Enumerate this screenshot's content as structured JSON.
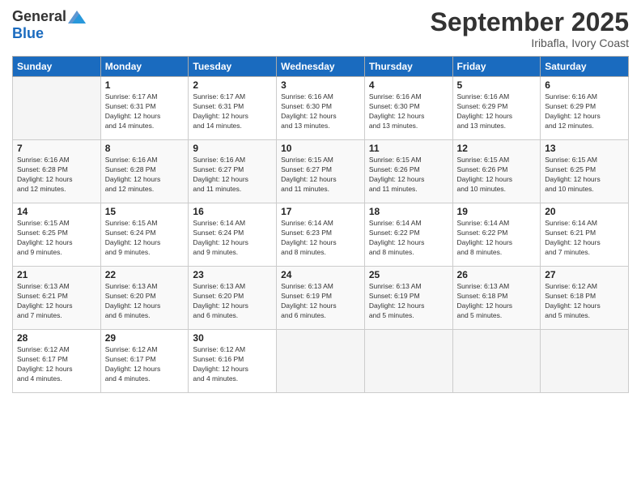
{
  "header": {
    "logo_general": "General",
    "logo_blue": "Blue",
    "month_title": "September 2025",
    "subtitle": "Iribafla, Ivory Coast"
  },
  "days_of_week": [
    "Sunday",
    "Monday",
    "Tuesday",
    "Wednesday",
    "Thursday",
    "Friday",
    "Saturday"
  ],
  "weeks": [
    [
      {
        "day": "",
        "info": ""
      },
      {
        "day": "1",
        "info": "Sunrise: 6:17 AM\nSunset: 6:31 PM\nDaylight: 12 hours\nand 14 minutes."
      },
      {
        "day": "2",
        "info": "Sunrise: 6:17 AM\nSunset: 6:31 PM\nDaylight: 12 hours\nand 14 minutes."
      },
      {
        "day": "3",
        "info": "Sunrise: 6:16 AM\nSunset: 6:30 PM\nDaylight: 12 hours\nand 13 minutes."
      },
      {
        "day": "4",
        "info": "Sunrise: 6:16 AM\nSunset: 6:30 PM\nDaylight: 12 hours\nand 13 minutes."
      },
      {
        "day": "5",
        "info": "Sunrise: 6:16 AM\nSunset: 6:29 PM\nDaylight: 12 hours\nand 13 minutes."
      },
      {
        "day": "6",
        "info": "Sunrise: 6:16 AM\nSunset: 6:29 PM\nDaylight: 12 hours\nand 12 minutes."
      }
    ],
    [
      {
        "day": "7",
        "info": "Sunrise: 6:16 AM\nSunset: 6:28 PM\nDaylight: 12 hours\nand 12 minutes."
      },
      {
        "day": "8",
        "info": "Sunrise: 6:16 AM\nSunset: 6:28 PM\nDaylight: 12 hours\nand 12 minutes."
      },
      {
        "day": "9",
        "info": "Sunrise: 6:16 AM\nSunset: 6:27 PM\nDaylight: 12 hours\nand 11 minutes."
      },
      {
        "day": "10",
        "info": "Sunrise: 6:15 AM\nSunset: 6:27 PM\nDaylight: 12 hours\nand 11 minutes."
      },
      {
        "day": "11",
        "info": "Sunrise: 6:15 AM\nSunset: 6:26 PM\nDaylight: 12 hours\nand 11 minutes."
      },
      {
        "day": "12",
        "info": "Sunrise: 6:15 AM\nSunset: 6:26 PM\nDaylight: 12 hours\nand 10 minutes."
      },
      {
        "day": "13",
        "info": "Sunrise: 6:15 AM\nSunset: 6:25 PM\nDaylight: 12 hours\nand 10 minutes."
      }
    ],
    [
      {
        "day": "14",
        "info": "Sunrise: 6:15 AM\nSunset: 6:25 PM\nDaylight: 12 hours\nand 9 minutes."
      },
      {
        "day": "15",
        "info": "Sunrise: 6:15 AM\nSunset: 6:24 PM\nDaylight: 12 hours\nand 9 minutes."
      },
      {
        "day": "16",
        "info": "Sunrise: 6:14 AM\nSunset: 6:24 PM\nDaylight: 12 hours\nand 9 minutes."
      },
      {
        "day": "17",
        "info": "Sunrise: 6:14 AM\nSunset: 6:23 PM\nDaylight: 12 hours\nand 8 minutes."
      },
      {
        "day": "18",
        "info": "Sunrise: 6:14 AM\nSunset: 6:22 PM\nDaylight: 12 hours\nand 8 minutes."
      },
      {
        "day": "19",
        "info": "Sunrise: 6:14 AM\nSunset: 6:22 PM\nDaylight: 12 hours\nand 8 minutes."
      },
      {
        "day": "20",
        "info": "Sunrise: 6:14 AM\nSunset: 6:21 PM\nDaylight: 12 hours\nand 7 minutes."
      }
    ],
    [
      {
        "day": "21",
        "info": "Sunrise: 6:13 AM\nSunset: 6:21 PM\nDaylight: 12 hours\nand 7 minutes."
      },
      {
        "day": "22",
        "info": "Sunrise: 6:13 AM\nSunset: 6:20 PM\nDaylight: 12 hours\nand 6 minutes."
      },
      {
        "day": "23",
        "info": "Sunrise: 6:13 AM\nSunset: 6:20 PM\nDaylight: 12 hours\nand 6 minutes."
      },
      {
        "day": "24",
        "info": "Sunrise: 6:13 AM\nSunset: 6:19 PM\nDaylight: 12 hours\nand 6 minutes."
      },
      {
        "day": "25",
        "info": "Sunrise: 6:13 AM\nSunset: 6:19 PM\nDaylight: 12 hours\nand 5 minutes."
      },
      {
        "day": "26",
        "info": "Sunrise: 6:13 AM\nSunset: 6:18 PM\nDaylight: 12 hours\nand 5 minutes."
      },
      {
        "day": "27",
        "info": "Sunrise: 6:12 AM\nSunset: 6:18 PM\nDaylight: 12 hours\nand 5 minutes."
      }
    ],
    [
      {
        "day": "28",
        "info": "Sunrise: 6:12 AM\nSunset: 6:17 PM\nDaylight: 12 hours\nand 4 minutes."
      },
      {
        "day": "29",
        "info": "Sunrise: 6:12 AM\nSunset: 6:17 PM\nDaylight: 12 hours\nand 4 minutes."
      },
      {
        "day": "30",
        "info": "Sunrise: 6:12 AM\nSunset: 6:16 PM\nDaylight: 12 hours\nand 4 minutes."
      },
      {
        "day": "",
        "info": ""
      },
      {
        "day": "",
        "info": ""
      },
      {
        "day": "",
        "info": ""
      },
      {
        "day": "",
        "info": ""
      }
    ]
  ]
}
